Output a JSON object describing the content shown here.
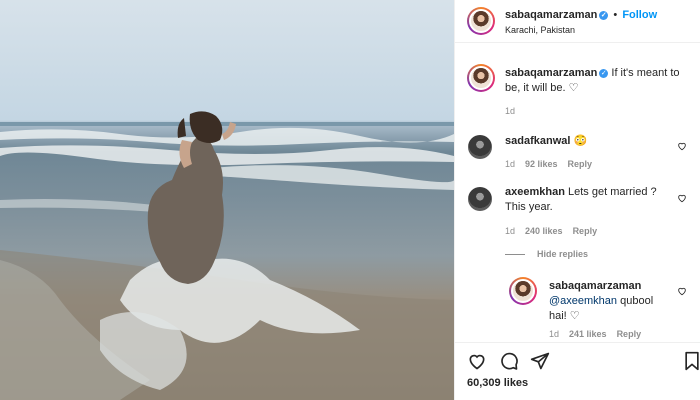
{
  "post": {
    "author": "sabaqamarzaman",
    "verified": true,
    "location": "Karachi, Pakistan",
    "follow_label": "Follow",
    "dot": "•"
  },
  "caption": {
    "author": "sabaqamarzaman",
    "text": "If it's meant to be, it will be. ♡",
    "time": "1d"
  },
  "comments": [
    {
      "author": "sadafkanwal",
      "text": "😳",
      "time": "1d",
      "likes": "92 likes",
      "reply": "Reply"
    },
    {
      "author": "axeemkhan",
      "text": "Lets get married ? This year.",
      "time": "1d",
      "likes": "240 likes",
      "reply": "Reply"
    }
  ],
  "hide_replies": "Hide replies",
  "reply": {
    "author": "sabaqamarzaman",
    "mention": "@axeemkhan",
    "text": " qubool hai! ♡",
    "time": "1d",
    "likes": "241 likes",
    "reply": "Reply"
  },
  "actions": {
    "likes_count": "60,309 likes",
    "icons": [
      "heart-icon",
      "comment-icon",
      "share-icon",
      "bookmark-icon"
    ]
  },
  "colors": {
    "accent": "#0095f6",
    "verified": "#3897f0",
    "meta": "#8e8e8e"
  }
}
